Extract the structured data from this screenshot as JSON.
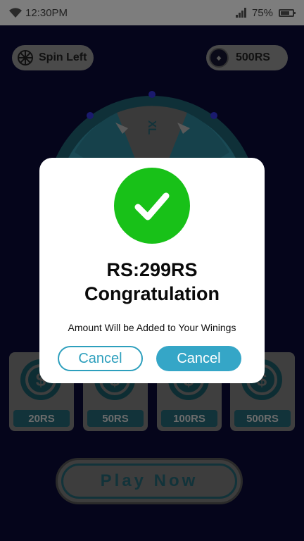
{
  "status_bar": {
    "time": "12:30PM",
    "battery_text": "75%",
    "battery_level": 0.75
  },
  "header": {
    "spin_left_label": "Spin Left",
    "balance_label": "500RS"
  },
  "wheel": {
    "segment_label": "XL"
  },
  "reward_cards": [
    {
      "amount": "20RS"
    },
    {
      "amount": "50RS"
    },
    {
      "amount": "100RS"
    },
    {
      "amount": "500RS"
    }
  ],
  "play_button_label": "Play Now",
  "dialog": {
    "amount": "RS:299RS",
    "title": "Congratulation",
    "message": "Amount Will be Added to Your Winings",
    "left_button": "Cancel",
    "right_button": "Cancel"
  },
  "colors": {
    "success": "#18c118",
    "accent": "#35a6c7"
  },
  "icons": {
    "status": [
      "wifi-icon",
      "signal-icon",
      "battery-icon"
    ],
    "header": [
      "spin-icon",
      "coin-icon"
    ],
    "dialog": "check-icon",
    "cards": "dollar-icon"
  }
}
